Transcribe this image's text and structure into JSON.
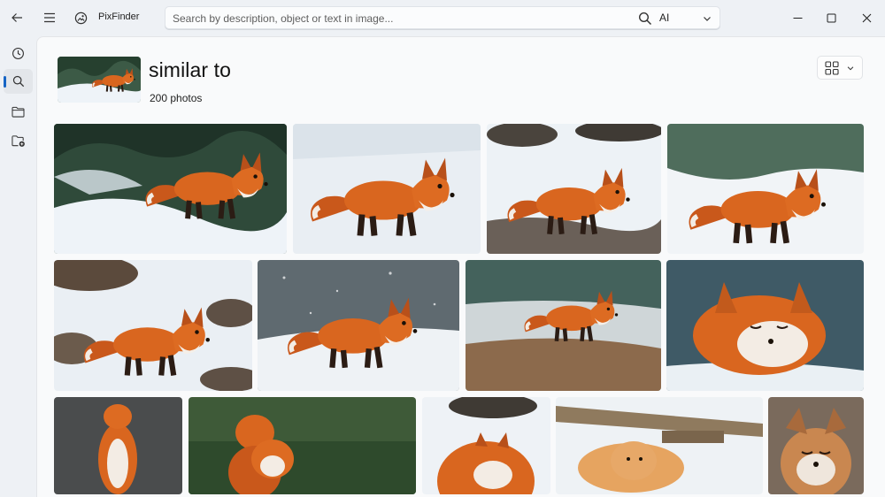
{
  "app": {
    "name": "PixFinder"
  },
  "search": {
    "placeholder": "Search by description, object or text in image...",
    "mode": "AI"
  },
  "rail": {
    "items": [
      {
        "icon": "clock-icon",
        "name": "recent",
        "active": false
      },
      {
        "icon": "search-icon",
        "name": "search",
        "active": true
      },
      {
        "icon": "folder-icon",
        "name": "folders",
        "active": false
      },
      {
        "icon": "folder-add-icon",
        "name": "add-folder",
        "active": false
      }
    ]
  },
  "results": {
    "title": "similar to",
    "count_label": "200 photos"
  },
  "photos": [
    {
      "id": 1,
      "scene": "fox lying in snow beside pine branches"
    },
    {
      "id": 2,
      "scene": "fox walking across snow"
    },
    {
      "id": 3,
      "scene": "fox trotting past rocks in snow"
    },
    {
      "id": 4,
      "scene": "fox in snow looking right"
    },
    {
      "id": 5,
      "scene": "fox standing on snowy rocks"
    },
    {
      "id": 6,
      "scene": "fox hunting in falling snow"
    },
    {
      "id": 7,
      "scene": "fox leaping over grassy field"
    },
    {
      "id": 8,
      "scene": "fox resting eyes closed in snowfall"
    },
    {
      "id": 9,
      "scene": "fox standing on hind legs"
    },
    {
      "id": 10,
      "scene": "two fox kits in green forest"
    },
    {
      "id": 11,
      "scene": "fox peeking over snow"
    },
    {
      "id": 12,
      "scene": "fox under wooden bench in snow"
    },
    {
      "id": 13,
      "scene": "fox face close-up"
    }
  ],
  "colors": {
    "accent": "#1765c5",
    "fox": "#d9661f",
    "snow": "#eef3f8"
  }
}
